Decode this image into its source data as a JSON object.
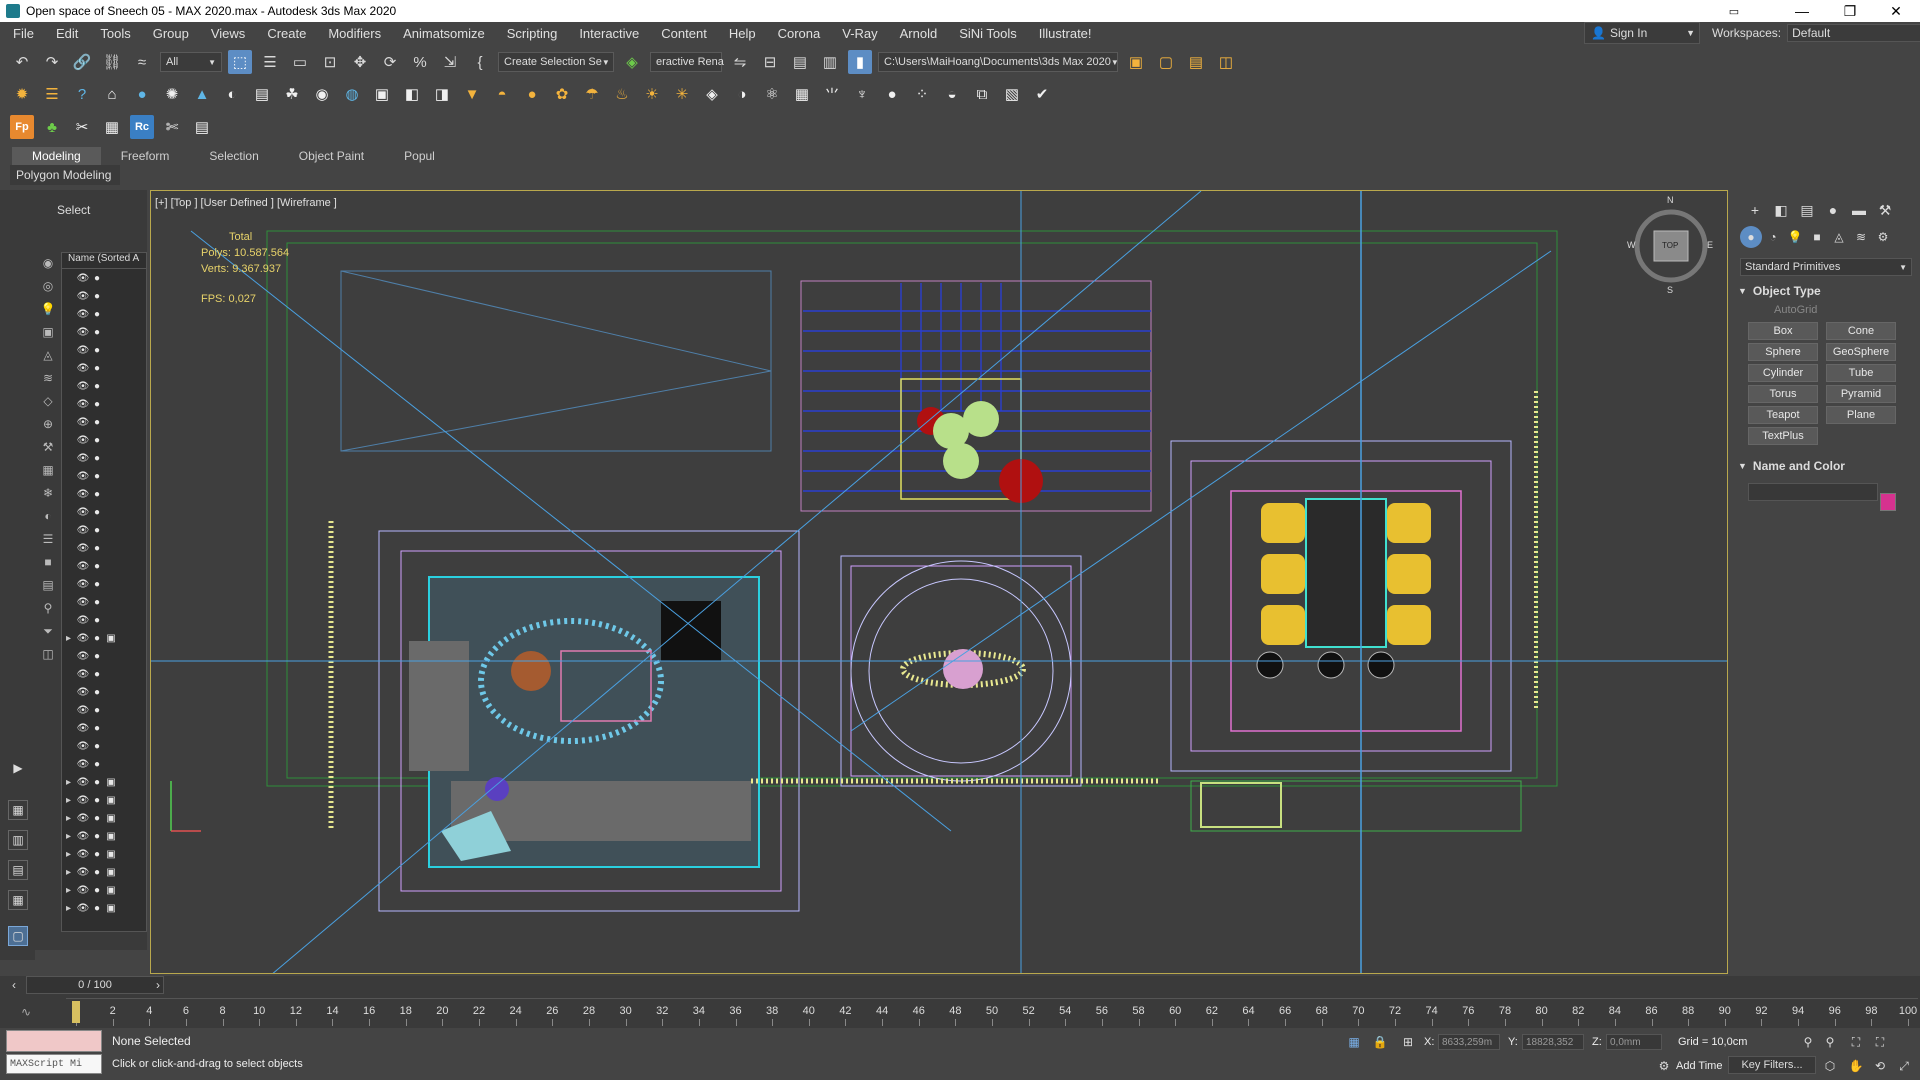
{
  "window": {
    "title": "Open space of Sneech 05 - MAX 2020.max - Autodesk 3ds Max 2020"
  },
  "menu": [
    "File",
    "Edit",
    "Tools",
    "Group",
    "Views",
    "Create",
    "Modifiers",
    "Animatsomize",
    "Scripting",
    "Interactive",
    "Content",
    "Help",
    "Corona",
    "V-Ray",
    "Arnold",
    "SiNi Tools",
    "Illustrate!"
  ],
  "account": {
    "sign_in": "Sign In",
    "workspaces_label": "Workspaces:",
    "workspace": "Default"
  },
  "toolbar": {
    "filter": "All",
    "selection_set": "Create Selection Se",
    "interactive_render": "eractive Rena",
    "project_path": "C:\\Users\\MaiHoang\\Documents\\3ds Max 2020"
  },
  "ribbon": {
    "tabs": [
      "Modeling",
      "Freeform",
      "Selection",
      "Object Paint",
      "Popul"
    ],
    "active": "Modeling",
    "sub": "Polygon Modeling"
  },
  "scene_explorer": {
    "title": "Select",
    "column": "Name (Sorted A"
  },
  "viewport": {
    "label": "[+] [Top ] [User Defined ] [Wireframe ]",
    "stats": {
      "total_label": "Total",
      "polys_label": "Polys:",
      "polys": "10.587.564",
      "verts_label": "Verts:",
      "verts": "9.367.937",
      "fps_label": "FPS:",
      "fps": "0,027"
    },
    "viewcube": {
      "n": "N",
      "s": "S",
      "w": "W",
      "e": "E",
      "face": "TOP"
    }
  },
  "command_panel": {
    "category": "Standard Primitives",
    "object_type_title": "Object Type",
    "autogrid": "AutoGrid",
    "primitives": [
      "Box",
      "Cone",
      "Sphere",
      "GeoSphere",
      "Cylinder",
      "Tube",
      "Torus",
      "Pyramid",
      "Teapot",
      "Plane",
      "TextPlus"
    ],
    "name_color_title": "Name and Color",
    "color": "#d6328f"
  },
  "timeline": {
    "frame": "0 / 100",
    "ticks": [
      "0",
      "2",
      "4",
      "6",
      "8",
      "10",
      "12",
      "14",
      "16",
      "18",
      "20",
      "22",
      "24",
      "26",
      "28",
      "30",
      "32",
      "34",
      "36",
      "38",
      "40",
      "42",
      "44",
      "46",
      "48",
      "50",
      "52",
      "54",
      "56",
      "58",
      "60",
      "62",
      "64",
      "66",
      "68",
      "70",
      "72",
      "74",
      "76",
      "78",
      "80",
      "82",
      "84",
      "86",
      "88",
      "90",
      "92",
      "94",
      "96",
      "98",
      "100"
    ]
  },
  "status": {
    "maxscript": "MAXScript Mi",
    "selection": "None Selected",
    "hint": "Click or click-and-drag to select objects",
    "x_label": "X:",
    "x": "8633,259m",
    "y_label": "Y:",
    "y": "18828,352",
    "z_label": "Z:",
    "z": "0,0mm",
    "grid": "Grid = 10,0cm",
    "add_time": "Add Time",
    "key_filters": "Key Filters..."
  }
}
